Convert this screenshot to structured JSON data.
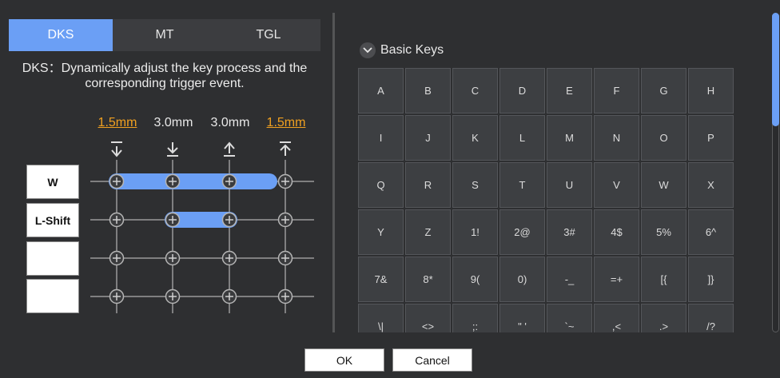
{
  "tabs": [
    {
      "label": "DKS",
      "active": true
    },
    {
      "label": "MT",
      "active": false
    },
    {
      "label": "TGL",
      "active": false
    }
  ],
  "description": "DKS：Dynamically adjust the key process and the corresponding trigger event.",
  "distances": [
    {
      "label": "1.5mm",
      "highlight": true
    },
    {
      "label": "3.0mm",
      "highlight": false
    },
    {
      "label": "3.0mm",
      "highlight": false
    },
    {
      "label": "1.5mm",
      "highlight": true
    }
  ],
  "stage_icons": [
    "press-start-icon",
    "press-bottom-icon",
    "release-start-icon",
    "release-top-icon"
  ],
  "bindings": [
    {
      "key": "W",
      "bar": [
        0,
        3
      ]
    },
    {
      "key": "L-Shift",
      "bar": [
        1,
        2
      ]
    },
    {
      "key": "",
      "bar": null
    },
    {
      "key": "",
      "bar": null
    }
  ],
  "colors": {
    "accent": "#6b9ff5",
    "highlight": "#f0a020",
    "background": "#2e2f31"
  },
  "keys_panel": {
    "section_label": "Basic Keys",
    "keys": [
      "A",
      "B",
      "C",
      "D",
      "E",
      "F",
      "G",
      "H",
      "I",
      "J",
      "K",
      "L",
      "M",
      "N",
      "O",
      "P",
      "Q",
      "R",
      "S",
      "T",
      "U",
      "V",
      "W",
      "X",
      "Y",
      "Z",
      "1!",
      "2@",
      "3#",
      "4$",
      "5%",
      "6^",
      "7&",
      "8*",
      "9(",
      "0)",
      "-_",
      "=+",
      "[{",
      "]}",
      "\\|",
      "<>",
      ";:",
      "\" '",
      "`~",
      ",<",
      ".>",
      "/?"
    ]
  },
  "buttons": {
    "ok": "OK",
    "cancel": "Cancel"
  }
}
